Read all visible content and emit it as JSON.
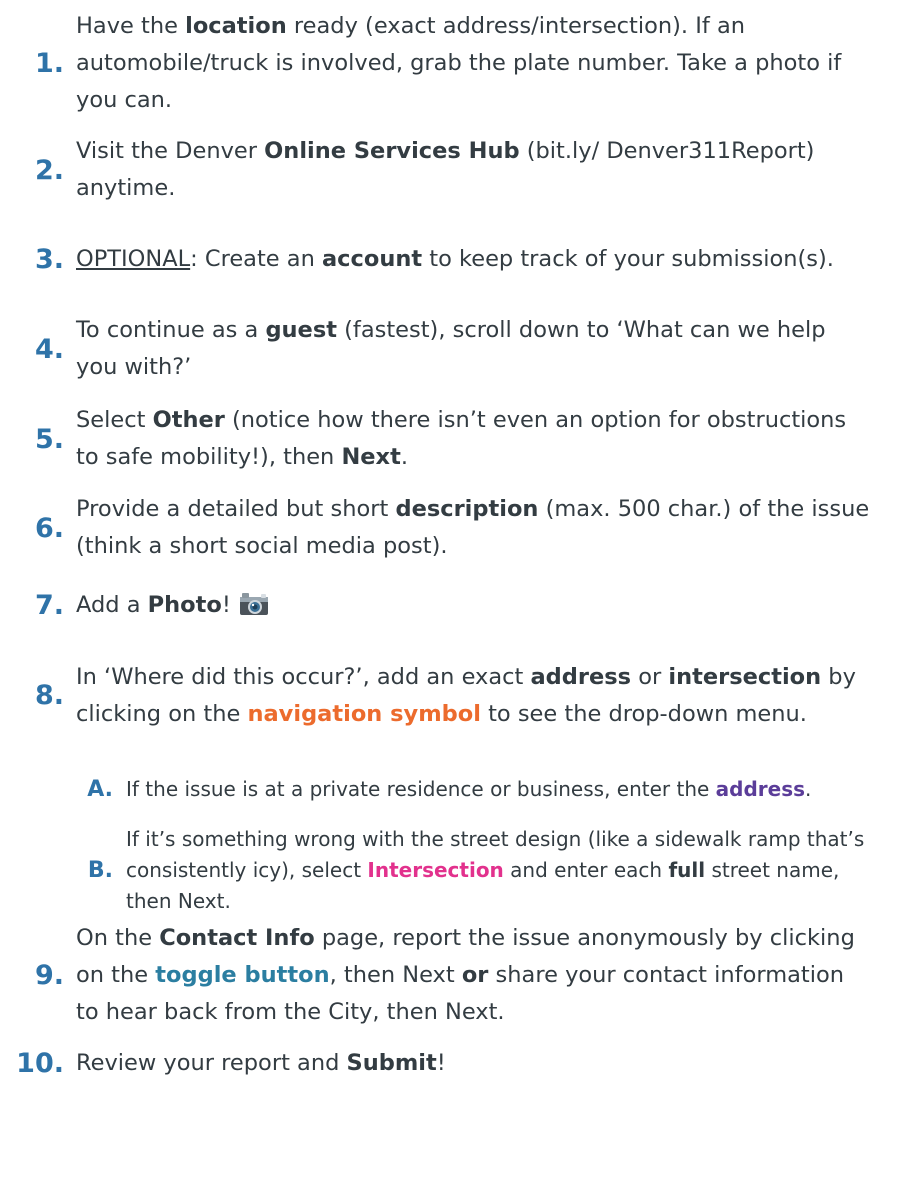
{
  "steps": [
    {
      "number": "1.",
      "parts": [
        {
          "t": "Have the "
        },
        {
          "t": "location",
          "s": "b"
        },
        {
          "t": " ready (exact address/intersection). If an automobile/truck is involved, grab the plate number. Take a photo if you can."
        }
      ]
    },
    {
      "number": "2.",
      "parts": [
        {
          "t": "Visit the Denver "
        },
        {
          "t": "Online Services Hub",
          "s": "b"
        },
        {
          "t": " (bit.ly/ Denver311Report) anytime."
        }
      ]
    },
    {
      "number": "3.",
      "parts": [
        {
          "t": "OPTIONAL",
          "s": "u"
        },
        {
          "t": ": Create an "
        },
        {
          "t": "account",
          "s": "b"
        },
        {
          "t": " to keep track of your submission(s)."
        }
      ]
    },
    {
      "number": "4.",
      "parts": [
        {
          "t": "To continue as a "
        },
        {
          "t": "guest",
          "s": "b"
        },
        {
          "t": " (fastest), scroll down to ‘What can we help you with?’"
        }
      ]
    },
    {
      "number": "5.",
      "parts": [
        {
          "t": "Select "
        },
        {
          "t": "Other",
          "s": "b"
        },
        {
          "t": " (notice how there isn’t even an option for obstructions to safe mobility!), then "
        },
        {
          "t": "Next",
          "s": "b"
        },
        {
          "t": "."
        }
      ]
    },
    {
      "number": "6.",
      "parts": [
        {
          "t": "Provide a detailed but short "
        },
        {
          "t": "description",
          "s": "b"
        },
        {
          "t": " (max. 500 char.) of the issue (think a short social media post)."
        }
      ]
    },
    {
      "number": "7.",
      "parts": [
        {
          "t": "Add a "
        },
        {
          "t": "Photo",
          "s": "b"
        },
        {
          "t": "!"
        }
      ],
      "icon": "camera-icon"
    },
    {
      "number": "8.",
      "parts": [
        {
          "t": "In ‘Where did this occur?’, add an exact "
        },
        {
          "t": "address",
          "s": "b"
        },
        {
          "t": " or "
        },
        {
          "t": "intersection",
          "s": "b"
        },
        {
          "t": " by clicking on the "
        },
        {
          "t": "navigation symbol",
          "s": "orange"
        },
        {
          "t": " to see the drop-down menu."
        }
      ]
    },
    {
      "number": "A.",
      "sub": true,
      "parts": [
        {
          "t": "If the issue is at a private residence or business, enter the "
        },
        {
          "t": "address",
          "s": "purple"
        },
        {
          "t": "."
        }
      ]
    },
    {
      "number": "B.",
      "sub": true,
      "parts": [
        {
          "t": "If it’s something wrong with the street design (like a sidewalk ramp that’s consistently icy), select "
        },
        {
          "t": "Intersection",
          "s": "pink"
        },
        {
          "t": " and enter each "
        },
        {
          "t": "full",
          "s": "b"
        },
        {
          "t": " street name, then Next."
        }
      ]
    },
    {
      "number": "9.",
      "parts": [
        {
          "t": "On the "
        },
        {
          "t": "Contact Info",
          "s": "b"
        },
        {
          "t": " page, report the issue anonymously by clicking on the "
        },
        {
          "t": "toggle button",
          "s": "teal"
        },
        {
          "t": ", then Next "
        },
        {
          "t": "or",
          "s": "b"
        },
        {
          "t": " share your contact information to hear back from the City, then Next."
        }
      ]
    },
    {
      "number": "10.",
      "parts": [
        {
          "t": "Review your report and "
        },
        {
          "t": "Submit",
          "s": "b"
        },
        {
          "t": "!"
        }
      ]
    }
  ]
}
